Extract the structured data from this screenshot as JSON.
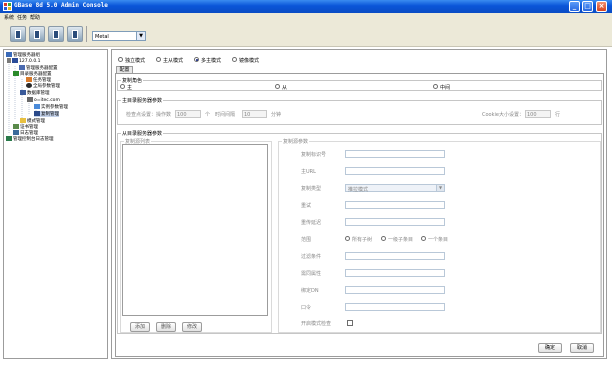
{
  "window": {
    "title": "GBase 8d 5.0 Admin Console",
    "controls": {
      "minimize": "_",
      "maximize": "□",
      "close": "×"
    }
  },
  "menu": [
    "系统",
    "任务",
    "帮助"
  ],
  "toolbar": {
    "theme_value": "Metal",
    "theme_arrow": "▼",
    "buttons": [
      "toolbar-button-1",
      "toolbar-button-2",
      "toolbar-button-3",
      "toolbar-button-4"
    ]
  },
  "tree": {
    "root": "管理服务器组",
    "host": "127.0.0.1",
    "mgr_config": "管理服务器配置",
    "dir_config": "目录服务器配置",
    "task_mgmt": "任务管理",
    "global_param": "全局参数管理",
    "data_mgmt": "数据库管理",
    "domain": "o=itec.com",
    "instance_mgmt": "实例参数管理",
    "repl_mgmt": "复制管理",
    "schema_mgmt": "模式管理",
    "cert_mgmt": "证书管理",
    "log_mgmt": "日志管理",
    "audit_mgmt": "管理控制台日志管理"
  },
  "mode": {
    "options": [
      "独立模式",
      "主从模式",
      "多主模式",
      "镜像模式"
    ],
    "selected_index": 2
  },
  "tab_label": "配置",
  "role": {
    "legend": "复制角色",
    "options": [
      "主",
      "从",
      "中间"
    ]
  },
  "master": {
    "legend": "主目录服务器参数",
    "checkpoint_label": "检查点设置：操作数",
    "checkpoint_ops": "100",
    "unit_count": "个",
    "interval_label": "时间间隔",
    "interval_value": "10",
    "unit_min": "分钟",
    "cookie_label": "Cookie大小设置：",
    "cookie_value": "100",
    "unit_row": "行"
  },
  "slave": {
    "legend": "从目录服务器参数",
    "list_legend": "复制源列表",
    "add": "添加",
    "delete": "删除",
    "modify": "修改",
    "params_legend": "复制源参数",
    "fields": {
      "id": "复制标识号",
      "url": "主URL",
      "type": "复制类型",
      "type_value": "推拉模式",
      "retry": "重试",
      "retry_interval": "重传延迟",
      "scope": "范围",
      "scope_options": [
        "所有子树",
        "一级子条目",
        "一个条目"
      ],
      "filter": "过滤条件",
      "attrs": "需同属性",
      "bind_dn": "绑定DN",
      "password": "口令",
      "tls": "开启模式检查"
    }
  },
  "footer": {
    "ok": "确定",
    "cancel": "取消"
  }
}
